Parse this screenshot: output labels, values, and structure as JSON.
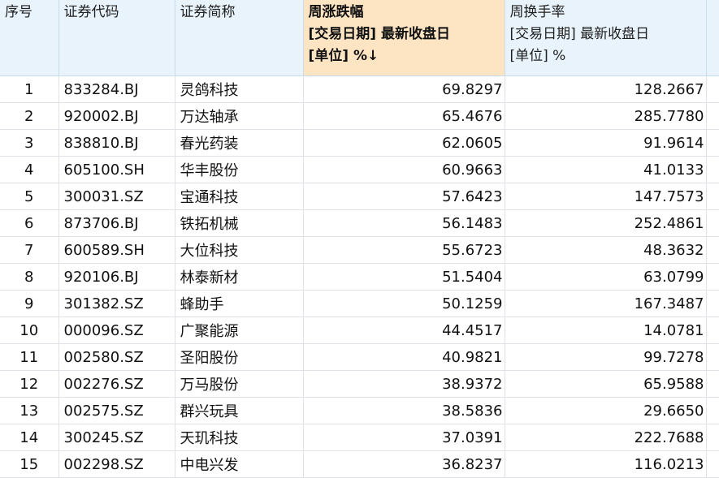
{
  "headers": {
    "seq": "序号",
    "code": "证券代码",
    "name": "证券简称",
    "weekly_change": [
      "周涨跌幅",
      "[交易日期] 最新收盘日",
      "[单位] %↓"
    ],
    "weekly_turnover": [
      "周换手率",
      "[交易日期] 最新收盘日",
      "[单位] %"
    ]
  },
  "rows": [
    {
      "seq": "1",
      "code": "833284.BJ",
      "name": "灵鸽科技",
      "change": "69.8297",
      "turnover": "128.2667"
    },
    {
      "seq": "2",
      "code": "920002.BJ",
      "name": "万达轴承",
      "change": "65.4676",
      "turnover": "285.7780"
    },
    {
      "seq": "3",
      "code": "838810.BJ",
      "name": "春光药装",
      "change": "62.0605",
      "turnover": "91.9614"
    },
    {
      "seq": "4",
      "code": "605100.SH",
      "name": "华丰股份",
      "change": "60.9663",
      "turnover": "41.0133"
    },
    {
      "seq": "5",
      "code": "300031.SZ",
      "name": "宝通科技",
      "change": "57.6423",
      "turnover": "147.7573"
    },
    {
      "seq": "6",
      "code": "873706.BJ",
      "name": "铁拓机械",
      "change": "56.1483",
      "turnover": "252.4861"
    },
    {
      "seq": "7",
      "code": "600589.SH",
      "name": "大位科技",
      "change": "55.6723",
      "turnover": "48.3632"
    },
    {
      "seq": "8",
      "code": "920106.BJ",
      "name": "林泰新材",
      "change": "51.5404",
      "turnover": "63.0799"
    },
    {
      "seq": "9",
      "code": "301382.SZ",
      "name": "蜂助手",
      "change": "50.1259",
      "turnover": "167.3487"
    },
    {
      "seq": "10",
      "code": "000096.SZ",
      "name": "广聚能源",
      "change": "44.4517",
      "turnover": "14.0781"
    },
    {
      "seq": "11",
      "code": "002580.SZ",
      "name": "圣阳股份",
      "change": "40.9821",
      "turnover": "99.7278"
    },
    {
      "seq": "12",
      "code": "002276.SZ",
      "name": "万马股份",
      "change": "38.9372",
      "turnover": "65.9588"
    },
    {
      "seq": "13",
      "code": "002575.SZ",
      "name": "群兴玩具",
      "change": "38.5836",
      "turnover": "29.6650"
    },
    {
      "seq": "14",
      "code": "300245.SZ",
      "name": "天玑科技",
      "change": "37.0391",
      "turnover": "222.7688"
    },
    {
      "seq": "15",
      "code": "002298.SZ",
      "name": "中电兴发",
      "change": "36.8237",
      "turnover": "116.0213"
    }
  ],
  "colors": {
    "header_bg": "#e8f3fc",
    "sorted_header_bg": "#fde5c4",
    "grid": "#dfe3e8"
  }
}
